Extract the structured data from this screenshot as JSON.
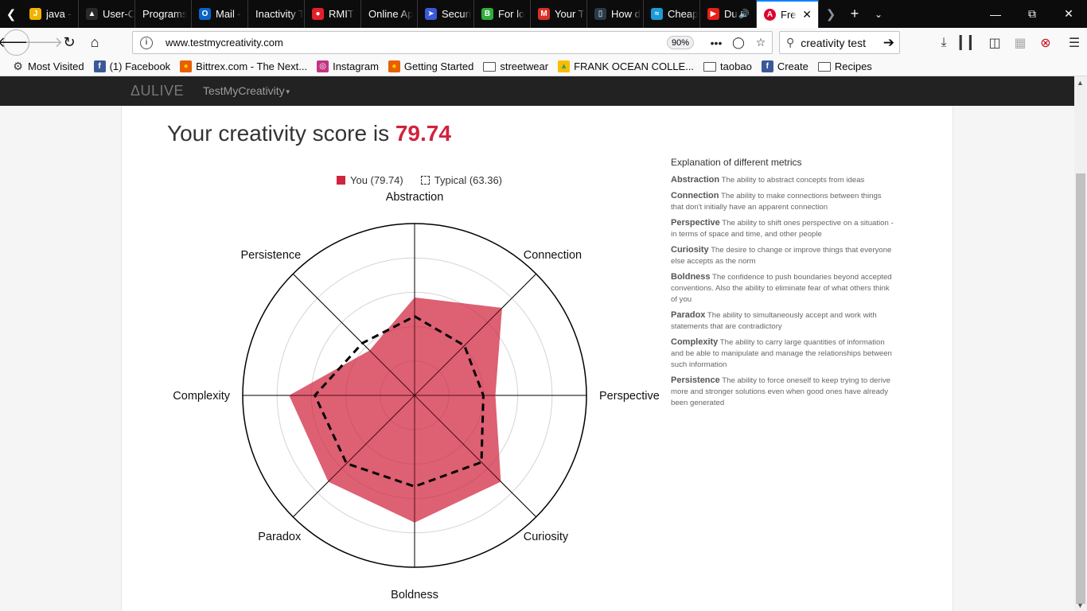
{
  "browser": {
    "tabs": [
      {
        "title": "java -",
        "icon": "java-icon",
        "color": "#f0b400"
      },
      {
        "title": "User-C",
        "icon": "hat-icon",
        "color": "#2a2a2a"
      },
      {
        "title": "Programs",
        "icon": "",
        "color": ""
      },
      {
        "title": "Mail -",
        "icon": "outlook-icon",
        "color": "#0a64c8"
      },
      {
        "title": "Inactivity T",
        "icon": "",
        "color": ""
      },
      {
        "title": "RMIT",
        "icon": "rmit-icon",
        "color": "#e61e2a"
      },
      {
        "title": "Online Ap",
        "icon": "",
        "color": ""
      },
      {
        "title": "Securi",
        "icon": "arrow-icon",
        "color": "#3a5ad8"
      },
      {
        "title": "For lo",
        "icon": "b-icon",
        "color": "#2fae3a"
      },
      {
        "title": "Your T",
        "icon": "gmail-icon",
        "color": "#d93025"
      },
      {
        "title": "How d",
        "icon": "page-icon",
        "color": "#2a3a4a"
      },
      {
        "title": "Cheap",
        "icon": "wave-icon",
        "color": "#1e9ad6"
      },
      {
        "title": "Du",
        "icon": "youtube-icon",
        "color": "#e62117"
      }
    ],
    "active_tab": {
      "title": "Fre",
      "icon": "angular-icon",
      "color": "#dd0031"
    },
    "url": "www.testmycreativity.com",
    "zoom": "90%",
    "search_value": "creativity test",
    "bookmarks": [
      {
        "label": "Most Visited",
        "icon": "gear-icon"
      },
      {
        "label": "(1) Facebook",
        "icon": "facebook-icon"
      },
      {
        "label": "Bittrex.com - The Next...",
        "icon": "firefox-icon"
      },
      {
        "label": "Instagram",
        "icon": "instagram-icon"
      },
      {
        "label": "Getting Started",
        "icon": "firefox-icon"
      },
      {
        "label": "streetwear",
        "icon": "folder-icon"
      },
      {
        "label": "FRANK OCEAN COLLE...",
        "icon": "drive-icon"
      },
      {
        "label": "taobao",
        "icon": "folder-icon"
      },
      {
        "label": "Create",
        "icon": "facebook-icon"
      },
      {
        "label": "Recipes",
        "icon": "folder-icon"
      }
    ]
  },
  "site": {
    "brand": "ΔULIVE",
    "menu": "TestMyCreativity"
  },
  "score": {
    "prefix": "Your creativity score is ",
    "value": "79.74"
  },
  "legend": {
    "you": "You (79.74)",
    "typical": "Typical (63.36)"
  },
  "chart_data": {
    "type": "radar",
    "axes": [
      "Abstraction",
      "Connection",
      "Perspective",
      "Curiosity",
      "Boldness",
      "Paradox",
      "Complexity",
      "Persistence"
    ],
    "range": [
      0,
      100
    ],
    "series": [
      {
        "name": "You (79.74)",
        "values": [
          57,
          72,
          47,
          71,
          74,
          71,
          73,
          37
        ],
        "color": "#d0233d"
      },
      {
        "name": "Typical (63.36)",
        "values": [
          46,
          41,
          40,
          55,
          53,
          56,
          58,
          43
        ],
        "color": "#000000"
      }
    ]
  },
  "explanation": {
    "title": "Explanation of different metrics",
    "items": [
      {
        "name": "Abstraction",
        "text": "The ability to abstract concepts from ideas"
      },
      {
        "name": "Connection",
        "text": "The ability to make connections between things that don't initially have an apparent connection"
      },
      {
        "name": "Perspective",
        "text": "The ability to shift ones perspective on a situation - in terms of space and time, and other people"
      },
      {
        "name": "Curiosity",
        "text": "The desire to change or improve things that everyone else accepts as the norm"
      },
      {
        "name": "Boldness",
        "text": "The confidence to push boundaries beyond accepted conventions. Also the ability to eliminate fear of what others think of you"
      },
      {
        "name": "Paradox",
        "text": "The ability to simultaneously accept and work with statements that are contradictory"
      },
      {
        "name": "Complexity",
        "text": "The ability to carry large quantities of information and be able to manipulate and manage the relationships between such information"
      },
      {
        "name": "Persistence",
        "text": "The ability to force oneself to keep trying to derive more and stronger solutions even when good ones have already been generated"
      }
    ]
  }
}
